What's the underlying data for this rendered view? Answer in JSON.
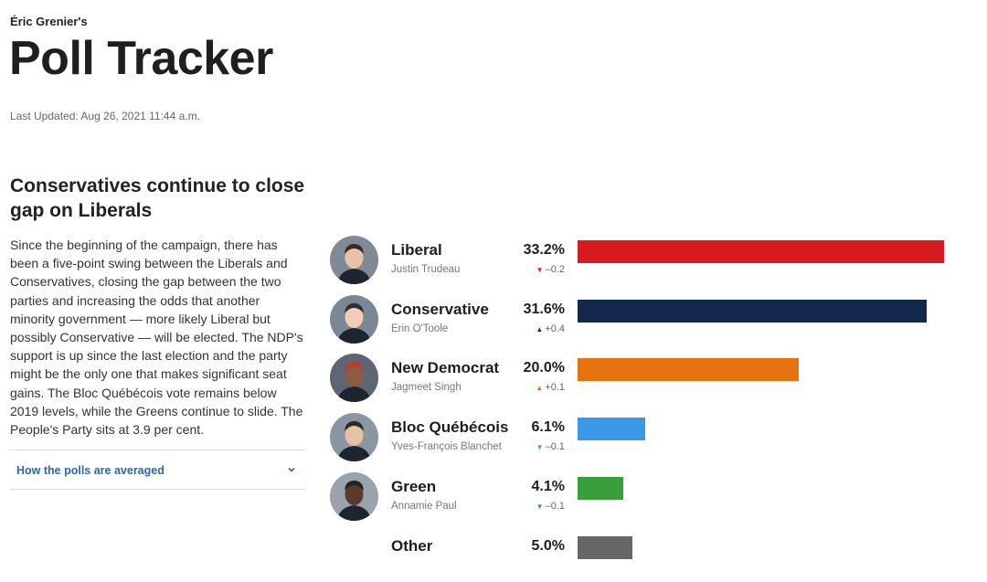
{
  "header": {
    "byline": "Éric Grenier's",
    "title": "Poll Tracker",
    "updated": "Last Updated: Aug 26, 2021 11:44 a.m."
  },
  "article": {
    "headline": "Conservatives continue to close gap on Liberals",
    "body": "Since the beginning of the campaign, there has been a five-point swing between the Liberals and Conservatives, closing the gap between the two parties and increasing the odds that another minority government — more likely Liberal but possibly Conservative — will be elected. The NDP's support is up since the last election and the party might be the only one that makes significant seat gains. The Bloc Québécois vote remains below 2019 levels, while the Greens continue to slide. The People's Party sits at 3.9 per cent.",
    "accordion_label": "How the polls are averaged"
  },
  "chart_data": {
    "type": "bar",
    "orientation": "horizontal",
    "categories": [
      "Liberal",
      "Conservative",
      "New Democrat",
      "Bloc Québécois",
      "Green",
      "Other"
    ],
    "values": [
      33.2,
      31.6,
      20.0,
      6.1,
      4.1,
      5.0
    ],
    "value_labels": [
      "33.2%",
      "31.6%",
      "20.0%",
      "6.1%",
      "4.1%",
      "5.0%"
    ],
    "leaders": [
      "Justin Trudeau",
      "Erin O'Toole",
      "Jagmeet Singh",
      "Yves-François Blanchet",
      "Annamie Paul",
      ""
    ],
    "changes": [
      "–0.2",
      "+0.4",
      "+0.1",
      "–0.1",
      "–0.1",
      ""
    ],
    "change_directions": [
      "down",
      "up",
      "up",
      "down",
      "down",
      ""
    ],
    "colors": [
      "#d71920",
      "#13294b",
      "#e4720f",
      "#3c97e8",
      "#3a9e3a",
      "#666666"
    ],
    "xlim": [
      0,
      33.2
    ]
  }
}
